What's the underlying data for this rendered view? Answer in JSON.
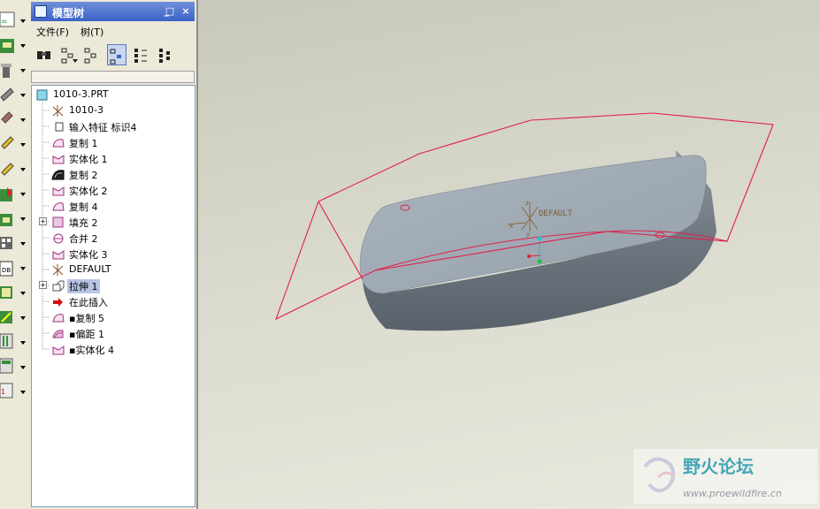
{
  "panel": {
    "title": "模型树",
    "min_glyph": "_",
    "max_glyph": "□",
    "close_glyph": "×"
  },
  "menu": {
    "file": "文件(F)",
    "tree": "树(T)"
  },
  "tree": {
    "items": [
      {
        "label": "1010-3.PRT",
        "icon": "part-icon"
      },
      {
        "label": "1010-3",
        "icon": "coordinate-system-icon"
      },
      {
        "label": "输入特征 标识4",
        "icon": "import-feature-icon"
      },
      {
        "label": "复制 1",
        "icon": "copy-surface-icon"
      },
      {
        "label": "实体化 1",
        "icon": "solidify-icon"
      },
      {
        "label": "复制 2",
        "icon": "copy-surface-dark-icon"
      },
      {
        "label": "实体化 2",
        "icon": "solidify-icon"
      },
      {
        "label": "复制 4",
        "icon": "copy-surface-icon"
      },
      {
        "label": "填充 2",
        "icon": "fill-icon"
      },
      {
        "label": "合并 2",
        "icon": "merge-icon"
      },
      {
        "label": "实体化 3",
        "icon": "solidify-icon"
      },
      {
        "label": "DEFAULT",
        "icon": "coordinate-system-icon"
      },
      {
        "label": "拉伸 1",
        "icon": "extrude-icon"
      },
      {
        "label": "在此插入",
        "icon": "insert-here-arrow-icon"
      },
      {
        "label": "▪复制 5",
        "icon": "copy-surface-icon"
      },
      {
        "label": "▪偏距 1",
        "icon": "offset-icon"
      },
      {
        "label": "▪实体化 4",
        "icon": "solidify-icon"
      }
    ]
  },
  "viewport": {
    "csys_label": "DEFAULT",
    "axis_x": "x",
    "axis_y": "y",
    "axis_z": "z"
  },
  "watermark": {
    "name": "野火论坛",
    "url": "www.proewildfire.cn"
  },
  "colors": {
    "model_fill": "#9aa5b0",
    "wire": "#e0204a",
    "title_bar": "#3b62c6"
  }
}
